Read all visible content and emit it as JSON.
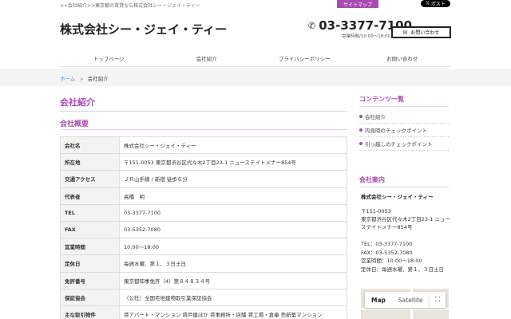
{
  "header": {
    "tagline": "<<会社紹介>>東京都の賃貸なら株式会社シー・ジェイ・ティー",
    "sitemap_label": "サイトマップ",
    "x_post_label": "ポスト",
    "brand": "株式会社シー・ジェイ・ティー",
    "phone": "03-3377-7100",
    "hours": "営業時間/10:00〜18:00",
    "contact_label": "お問い合わせ"
  },
  "nav": [
    {
      "label": "トップページ"
    },
    {
      "label": "会社紹介"
    },
    {
      "label": "プライバシーポリシー"
    },
    {
      "label": "お問い合わせ"
    }
  ],
  "breadcrumb": {
    "home": "ホーム",
    "separator": ">",
    "current": "会社紹介"
  },
  "main": {
    "title": "会社紹介",
    "section_title": "会社概要",
    "rows": [
      {
        "label": "会社名",
        "value": "株式会社シー・ジェイ・ティー"
      },
      {
        "label": "所在地",
        "value": "〒151-0053 東京都渋谷区代々木2丁目23-1 ニューステイトメナー854号"
      },
      {
        "label": "交通アクセス",
        "value": "ＪＲ山手線 / 新宿 徒歩６分"
      },
      {
        "label": "代表者",
        "value": "高橋　明"
      },
      {
        "label": "TEL",
        "value": "03-3377-7100"
      },
      {
        "label": "FAX",
        "value": "03-5352-7080"
      },
      {
        "label": "営業時間",
        "value": "10:00〜18:00"
      },
      {
        "label": "定休日",
        "value": "毎週水曜、第１、３日土日"
      },
      {
        "label": "免許番号",
        "value": "東京都知事免許（4）第８４８３４号"
      },
      {
        "label": "保証協会",
        "value": "（公社）全国宅地建物取引業保証協会"
      },
      {
        "label": "主な取引物件",
        "value": "賃アパート・マンション 賃戸建ほか 賃事務所・店舗 賃工場・倉庫 売新築マンション"
      }
    ]
  },
  "sidebar": {
    "contents_title": "コンテンツ一覧",
    "contents_items": [
      {
        "label": "会社紹介"
      },
      {
        "label": "内見時のチェックポイント"
      },
      {
        "label": "引っ越しのチェックポイント"
      }
    ],
    "company_title": "会社案内",
    "company_name": "株式会社シー・ジェイ・ティー",
    "address": "〒151-0053\n東京都渋谷区代々木2丁目23-1 ニューステイトメナー854号",
    "tel": "TEL：03-3377-7100",
    "fax": "FAX：03-5352-7080",
    "business_hours": "営業時間：10:00〜18:00",
    "holiday": "定休日：毎週水曜、第１、３日土日",
    "map": {
      "map_label": "Map",
      "satellite_label": "Satellite"
    }
  },
  "colors": {
    "accent": "#a94bb3",
    "link": "#4a8fcf"
  }
}
